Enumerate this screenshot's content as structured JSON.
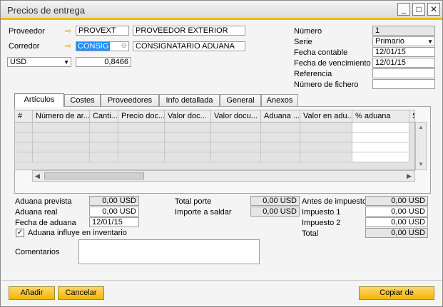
{
  "window": {
    "title": "Precios de entrega"
  },
  "header": {
    "proveedor_label": "Proveedor",
    "proveedor_code": "PROVEXT",
    "proveedor_name": "PROVEEDOR EXTERIOR",
    "corredor_label": "Corredor",
    "corredor_code": "CONSIG",
    "corredor_name": "CONSIGNATARIO ADUANA",
    "currency": "USD",
    "rate": "0,8466"
  },
  "doc": {
    "numero_label": "Número",
    "numero_value": "1",
    "serie_label": "Serie",
    "serie_value": "Primario",
    "fecha_contable_label": "Fecha contable",
    "fecha_contable_value": "12/01/15",
    "fecha_venc_label": "Fecha de vencimiento",
    "fecha_venc_value": "12/01/15",
    "referencia_label": "Referencia",
    "referencia_value": "",
    "numero_fichero_label": "Número de fichero",
    "numero_fichero_value": ""
  },
  "tabs": [
    {
      "label": "Artículos",
      "active": true
    },
    {
      "label": "Costes"
    },
    {
      "label": "Proveedores"
    },
    {
      "label": "Info detallada"
    },
    {
      "label": "General"
    },
    {
      "label": "Anexos"
    }
  ],
  "grid": {
    "headers": [
      "#",
      "Número de ar...",
      "Canti...",
      "Precio doc...",
      "Valor doc...",
      "Valor docu...",
      "Aduana ...",
      "Valor en adu...",
      "% aduana",
      "S"
    ]
  },
  "totals": {
    "aduana_prevista_label": "Aduana prevista",
    "aduana_prevista_value": "0,00 USD",
    "aduana_real_label": "Aduana real",
    "aduana_real_value": "0,00 USD",
    "fecha_aduana_label": "Fecha de aduana",
    "fecha_aduana_value": "12/01/15",
    "aduana_influye_label": "Aduana influye en inventario",
    "aduana_influye_checked": true,
    "total_porte_label": "Total porte",
    "total_porte_value": "0,00 USD",
    "importe_saldar_label": "Importe a saldar",
    "importe_saldar_value": "0,00 USD",
    "antes_impuestos_label": "Antes de impuestos",
    "antes_impuestos_value": "0,00 USD",
    "impuesto1_label": "Impuesto 1",
    "impuesto1_value": "0,00 USD",
    "impuesto2_label": "Impuesto 2",
    "impuesto2_value": "0,00 USD",
    "total_label": "Total",
    "total_value": "0,00 USD",
    "comentarios_label": "Comentarios",
    "comentarios_value": ""
  },
  "buttons": {
    "anadir": "Añadir",
    "cancelar": "Cancelar",
    "copiar_de": "Copiar de"
  },
  "colors": {
    "accent": "#f2b705",
    "title_line": "#f2b705",
    "highlight": "#1e90ff"
  }
}
